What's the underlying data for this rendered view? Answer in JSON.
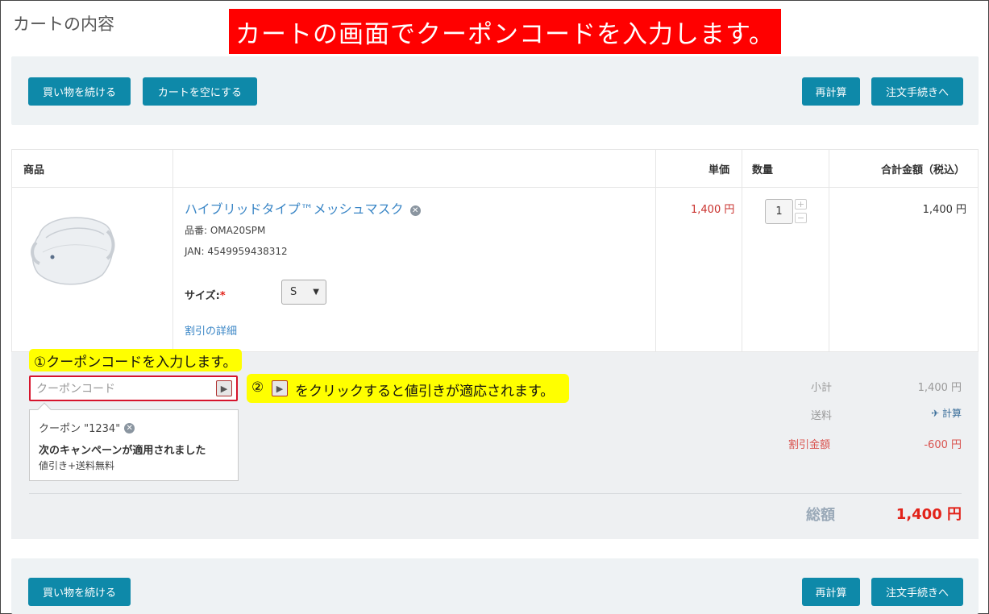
{
  "page": {
    "title": "カートの内容"
  },
  "banner": {
    "text": "カートの画面でクーポンコードを入力します。"
  },
  "actions": {
    "continue_shopping": "買い物を続ける",
    "empty_cart": "カートを空にする",
    "recalculate": "再計算",
    "checkout": "注文手続きへ"
  },
  "table": {
    "headers": {
      "product": "商品",
      "unit_price": "単価",
      "quantity": "数量",
      "total": "合計金額（税込）"
    },
    "item": {
      "name": "ハイブリッドタイプ™メッシュマスク",
      "sku": "品番: OMA20SPM",
      "jan": "JAN: 4549959438312",
      "size_label": "サイズ:",
      "size_required": "*",
      "size_value": "S",
      "discount_link": "割引の詳細",
      "unit_price": "1,400 円",
      "quantity": "1",
      "line_total": "1,400 円"
    }
  },
  "coupon": {
    "callout_step1": "①クーポンコードを入力します。",
    "placeholder": "クーポンコード",
    "callout_step2_prefix": "②",
    "callout_step2_text": "をクリックすると値引きが適応されます。",
    "applied_label": "クーポン \"1234\"",
    "applied_heading": "次のキャンペーンが適用されました",
    "applied_detail": "値引き+送料無料"
  },
  "summary": {
    "subtotal_label": "小計",
    "subtotal_value": "1,400 円",
    "shipping_label": "送料",
    "shipping_link": "計算",
    "discount_label": "割引金額",
    "discount_value": "-600 円",
    "total_label": "総額",
    "total_value": "1,400 円"
  },
  "colors": {
    "accent": "#0e89a9",
    "banner": "#ff0000",
    "highlight": "#ffff00",
    "price": "#c9302c"
  },
  "icons": {
    "remove": "close-circle-icon",
    "apply": "play-icon",
    "shipping": "airplane-icon"
  }
}
